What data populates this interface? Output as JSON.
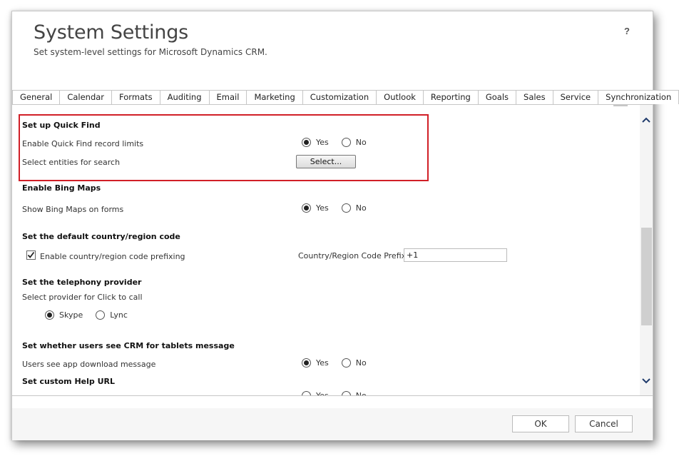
{
  "header": {
    "title": "System Settings",
    "subtitle": "Set system-level settings for Microsoft Dynamics CRM.",
    "help_label": "?"
  },
  "tabs": [
    {
      "label": "General",
      "active": true
    },
    {
      "label": "Calendar"
    },
    {
      "label": "Formats"
    },
    {
      "label": "Auditing"
    },
    {
      "label": "Email"
    },
    {
      "label": "Marketing"
    },
    {
      "label": "Customization"
    },
    {
      "label": "Outlook"
    },
    {
      "label": "Reporting"
    },
    {
      "label": "Goals"
    },
    {
      "label": "Sales"
    },
    {
      "label": "Service"
    },
    {
      "label": "Synchronization"
    }
  ],
  "quick_find": {
    "heading": "Set up Quick Find",
    "record_limits_label": "Enable Quick Find record limits",
    "record_limits_value": "Yes",
    "entities_label": "Select entities for search",
    "select_button": "Select..."
  },
  "bing_maps": {
    "heading": "Enable Bing Maps",
    "show_label": "Show Bing Maps on forms",
    "value": "Yes"
  },
  "country_code": {
    "heading": "Set the default country/region code",
    "prefixing_label": "Enable country/region code prefixing",
    "prefixing_checked": true,
    "prefix_label": "Country/Region Code Prefix",
    "prefix_value": "+1"
  },
  "telephony": {
    "heading": "Set the telephony provider",
    "provider_label": "Select provider for Click to call",
    "options": [
      "Skype",
      "Lync"
    ],
    "value": "Skype"
  },
  "tablets": {
    "heading": "Set whether users see CRM for tablets message",
    "message_label": "Users see app download message",
    "value": "Yes"
  },
  "help_url": {
    "heading": "Set custom Help URL"
  },
  "radio_options": {
    "yes": "Yes",
    "no": "No"
  },
  "footer": {
    "ok_label": "OK",
    "cancel_label": "Cancel"
  },
  "colors": {
    "highlight_border": "#d11f27",
    "footer_bg": "#f6f6f6",
    "tab_border": "#c6c6c6"
  }
}
